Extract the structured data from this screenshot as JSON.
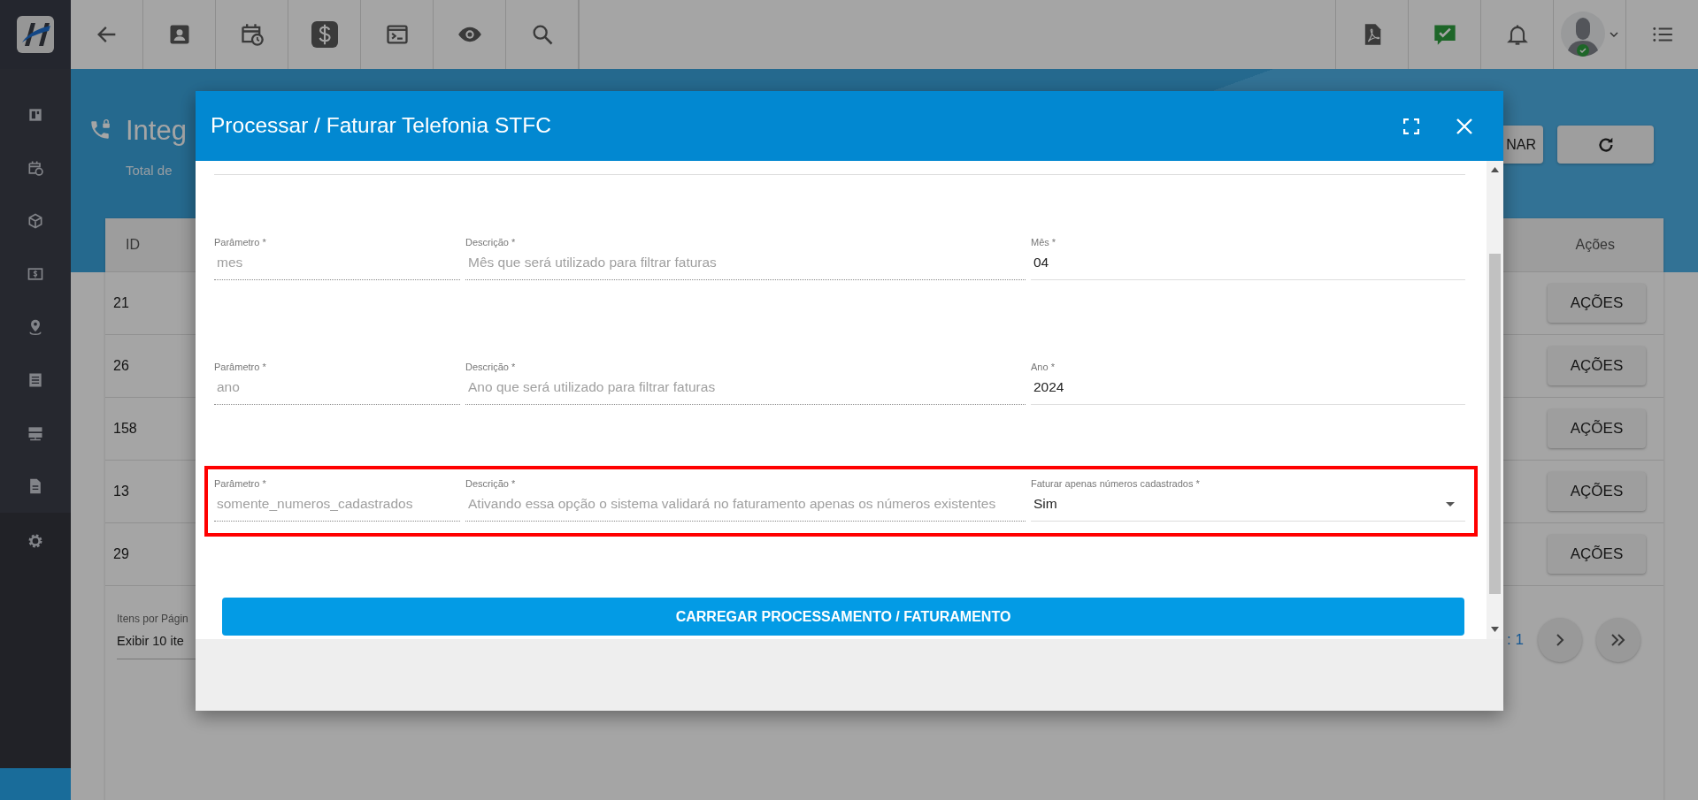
{
  "page": {
    "title": "Integ",
    "subtitle": "Total de",
    "action_button": "NAR"
  },
  "table": {
    "columns": [
      "ID",
      "Ações"
    ],
    "rows": [
      {
        "id": "21",
        "action": "AÇÕES"
      },
      {
        "id": "26",
        "action": "AÇÕES"
      },
      {
        "id": "158",
        "action": "AÇÕES"
      },
      {
        "id": "13",
        "action": "AÇÕES"
      },
      {
        "id": "29",
        "action": "AÇÕES"
      }
    ]
  },
  "pagination": {
    "per_page_label": "Itens por Págin",
    "per_page_value": "Exibir 10 ite",
    "page_info": ": 1"
  },
  "modal": {
    "title": "Processar / Faturar Telefonia STFC",
    "fields": [
      {
        "parameter_label": "Parâmetro *",
        "parameter": "mes",
        "description_label": "Descrição *",
        "description": "Mês que será utilizado para filtrar faturas",
        "value_label": "Mês *",
        "value": "04",
        "kind": "input",
        "highlighted": false
      },
      {
        "parameter_label": "Parâmetro *",
        "parameter": "ano",
        "description_label": "Descrição *",
        "description": "Ano que será utilizado para filtrar faturas",
        "value_label": "Ano *",
        "value": "2024",
        "kind": "input",
        "highlighted": false
      },
      {
        "parameter_label": "Parâmetro *",
        "parameter": "somente_numeros_cadastrados",
        "description_label": "Descrição *",
        "description": "Ativando essa opção o sistema validará no faturamento apenas os números existentes",
        "value_label": "Faturar apenas números cadastrados *",
        "value": "Sim",
        "kind": "select",
        "highlighted": true
      }
    ],
    "submit_button": "CARREGAR PROCESSAMENTO / FATURAMENTO"
  }
}
